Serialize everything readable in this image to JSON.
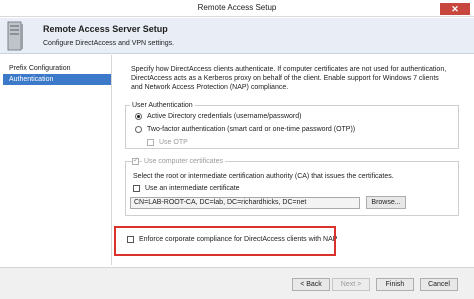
{
  "window": {
    "title": "Remote Access Setup",
    "close_glyph": "✕"
  },
  "header": {
    "heading": "Remote Access Server Setup",
    "subheading": "Configure DirectAccess and VPN settings.",
    "icon": "server-icon"
  },
  "nav": {
    "items": [
      {
        "label": "Prefix Configuration",
        "selected": false
      },
      {
        "label": "Authentication",
        "selected": true
      }
    ]
  },
  "description": "Specify how DirectAccess clients authenticate. If computer certificates are not used for authentication, DirectAccess acts as a Kerberos proxy on behalf of the client. Enable support for Windows 7 clients and Network Access Protection (NAP) compliance.",
  "user_auth": {
    "title": "User Authentication",
    "option_ad": "Active Directory credentials (username/password)",
    "option_2fa": "Two-factor authentication (smart card or one-time password (OTP))",
    "use_otp": "Use OTP",
    "selected": "Active Directory credentials (username/password)"
  },
  "certs": {
    "title": "Use computer certificates",
    "instruction": "Select the root or intermediate certification authority (CA) that issues the certificates.",
    "intermediate_label": "Use an intermediate certificate",
    "ca_path": "CN=LAB-ROOT-CA, DC=lab, DC=richardhicks, DC=net",
    "browse_label": "Browse..."
  },
  "nap": {
    "label": "Enforce corporate compliance for DirectAccess clients with NAP",
    "highlight_color": "#d9322c"
  },
  "footer": {
    "back_label": "< Back",
    "next_label": "Next >",
    "finish_label": "Finish",
    "cancel_label": "Cancel"
  },
  "colors": {
    "selection": "#3c79c8",
    "header_bg": "#e9eef6"
  }
}
